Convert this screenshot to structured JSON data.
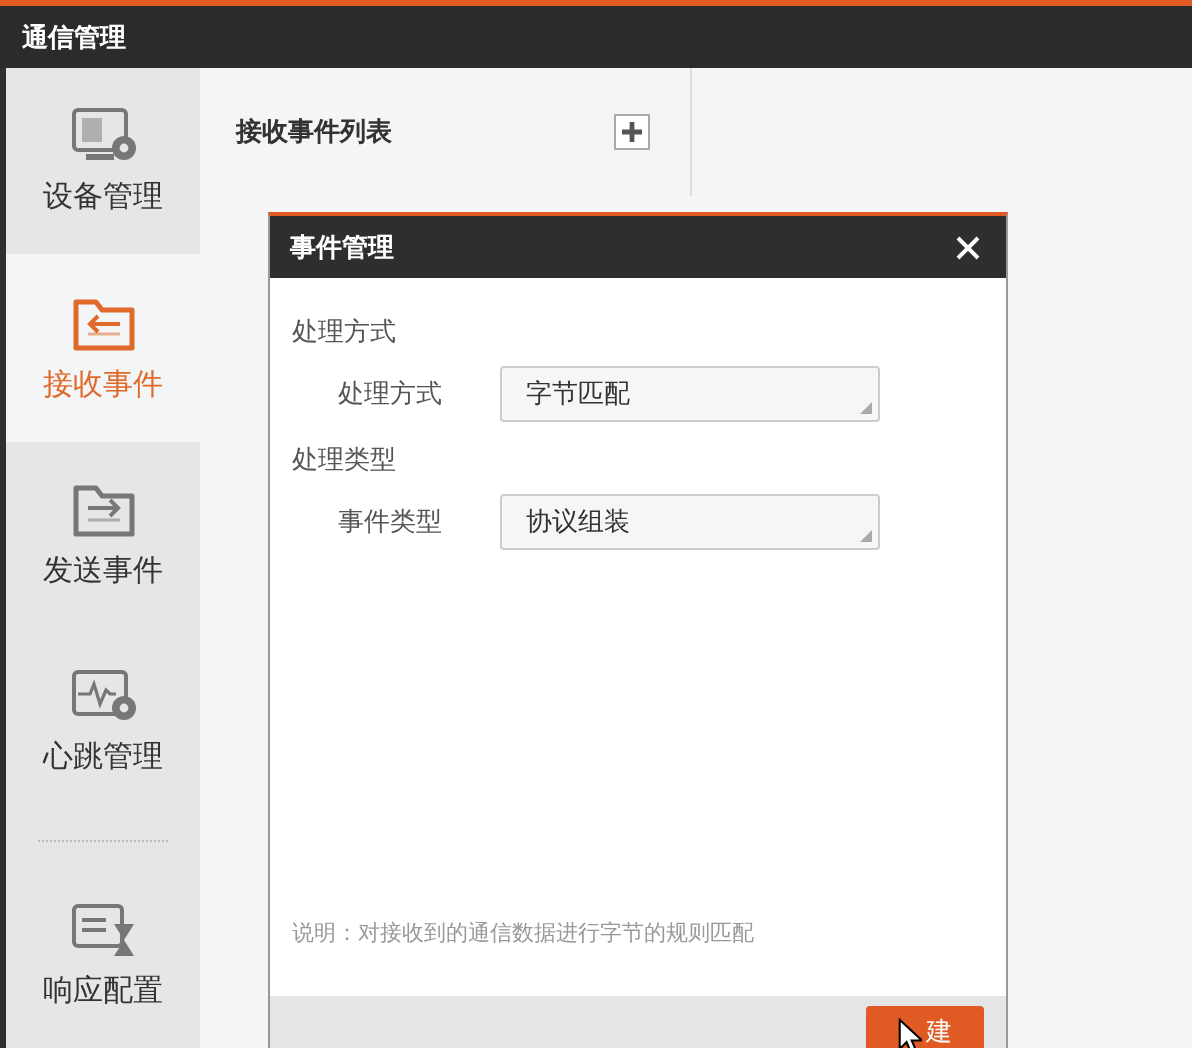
{
  "app": {
    "title": "通信管理"
  },
  "sidebar": {
    "items": [
      {
        "label": "设备管理",
        "kind": "device",
        "selected": false
      },
      {
        "label": "接收事件",
        "kind": "receive",
        "selected": true
      },
      {
        "label": "发送事件",
        "kind": "send",
        "selected": false
      },
      {
        "label": "心跳管理",
        "kind": "heartbeat",
        "selected": false
      },
      {
        "label": "响应配置",
        "kind": "response",
        "selected": false,
        "divider_before": true
      }
    ]
  },
  "panel": {
    "title": "接收事件列表"
  },
  "dialog": {
    "title": "事件管理",
    "sections": [
      {
        "title": "处理方式",
        "field": {
          "label": "处理方式",
          "value": "字节匹配"
        }
      },
      {
        "title": "处理类型",
        "field": {
          "label": "事件类型",
          "value": "协议组装"
        }
      }
    ],
    "note": "说明：对接收到的通信数据进行字节的规则匹配",
    "button": "建"
  }
}
